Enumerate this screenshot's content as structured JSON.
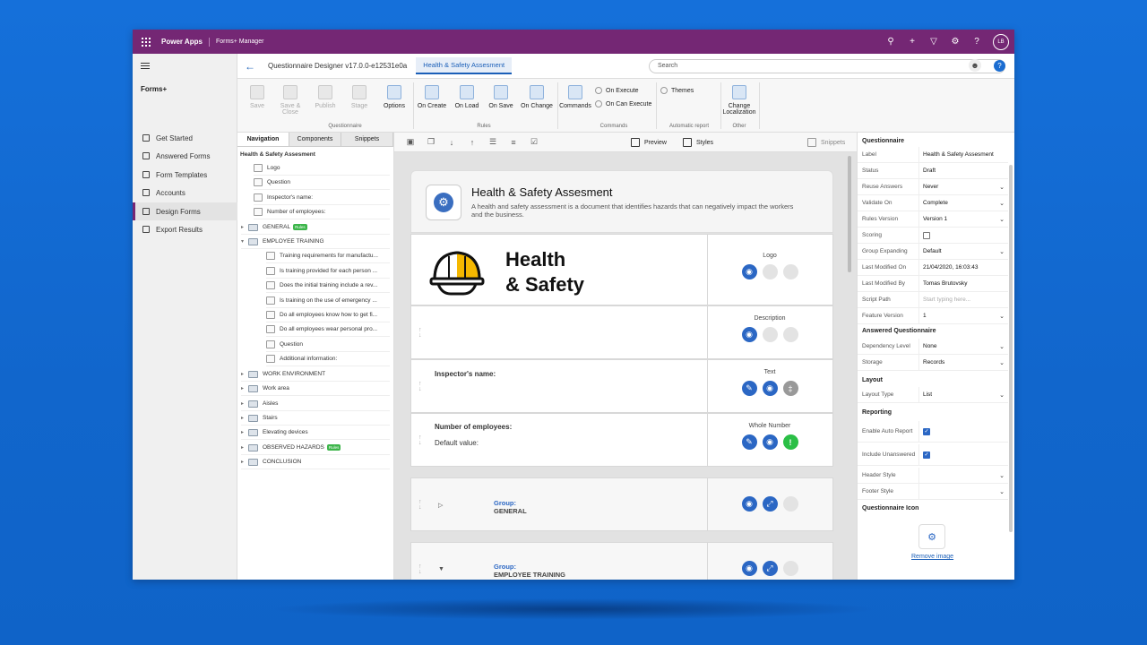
{
  "colors": {
    "accent": "#742774",
    "primary": "#2b67c4",
    "success": "#2bbf46",
    "background": "#1474d6"
  },
  "topbar": {
    "app_name": "Power Apps",
    "sub_app": "Forms+ Manager",
    "avatar": "LB",
    "icons": [
      "search-icon",
      "add-icon",
      "filter-icon",
      "gear-icon",
      "help-icon"
    ]
  },
  "leftnav": {
    "title": "Forms+",
    "items": [
      {
        "label": "Get Started",
        "icon": "doc-icon"
      },
      {
        "label": "Answered Forms",
        "icon": "doc-edit-icon"
      },
      {
        "label": "Form Templates",
        "icon": "template-icon"
      },
      {
        "label": "Accounts",
        "icon": "building-icon"
      },
      {
        "label": "Design Forms",
        "icon": "design-icon"
      },
      {
        "label": "Export Results",
        "icon": "export-icon"
      }
    ]
  },
  "header": {
    "designer_title": "Questionnaire Designer v17.0.0-e12531e0a",
    "tab": "Health & Safety Assesment",
    "search_placeholder": "Search"
  },
  "ribbon": {
    "buttons": [
      "Save",
      "Save & Close",
      "Publish",
      "Stage",
      "Options",
      "On Create",
      "On Load",
      "On Save",
      "On Change",
      "Commands",
      "Themes",
      "Change Localization"
    ],
    "small": [
      "On Execute",
      "On Can Execute"
    ],
    "groups": [
      "Questionnaire",
      "Rules",
      "Commands",
      "Automatic report",
      "Other"
    ]
  },
  "panel": {
    "tabs": [
      "Navigation",
      "Components",
      "Snippets"
    ],
    "root": "Health & Safety Assesment",
    "nodes": [
      "Logo",
      "Question",
      "Inspector's name:",
      "Number of employees:",
      "GENERAL",
      "EMPLOYEE TRAINING",
      "Training requirements for manufactu...",
      "Is training provided for each person ...",
      "Does the initial training include a rev...",
      "Is training on the use of emergency ...",
      "Do all employees know how to get fi...",
      "Do all employees wear personal pro...",
      "Question",
      "Additional information:",
      "WORK ENVIRONMENT",
      "Work area",
      "Aisles",
      "Stairs",
      "Elevating devices",
      "OBSERVED HAZARDS",
      "CONCLUSION"
    ],
    "badge": "Rules"
  },
  "canvas": {
    "preview": "Preview",
    "styles": "Styles",
    "snippets": "Snippets",
    "title": "Health & Safety Assesment",
    "description": "A health and safety assessment is a document that identifies hazards that can negatively impact the workers and the business.",
    "logo_text": [
      "Health",
      "& Safety"
    ],
    "rows": [
      {
        "type": "Logo"
      },
      {
        "type": "Description"
      },
      {
        "type": "Text",
        "label": "Inspector's name:"
      },
      {
        "type": "Whole Number",
        "label": "Number of employees:",
        "sub": "Default value:"
      }
    ],
    "groups": [
      {
        "g": "Group:",
        "name": "GENERAL"
      },
      {
        "g": "Group:",
        "name": "EMPLOYEE TRAINING"
      }
    ]
  },
  "props": {
    "sections": [
      "Questionnaire",
      "Answered Questionnaire",
      "Layout",
      "Reporting",
      "Questionnaire Icon"
    ],
    "rows": [
      {
        "k": "Label",
        "v": "Health & Safety Assesment"
      },
      {
        "k": "Status",
        "v": "Draft"
      },
      {
        "k": "Reuse Answers",
        "v": "Never"
      },
      {
        "k": "Validate On",
        "v": "Complete"
      },
      {
        "k": "Rules Version",
        "v": "Version 1"
      },
      {
        "k": "Scoring",
        "v": ""
      },
      {
        "k": "Group Expanding",
        "v": "Default"
      },
      {
        "k": "Last Modified On",
        "v": "21/04/2020, 16:03:43"
      },
      {
        "k": "Last Modified By",
        "v": "Tomas Brutovsky"
      },
      {
        "k": "Script Path",
        "v": "Start typing here..."
      },
      {
        "k": "Feature Version",
        "v": "1"
      },
      {
        "k": "Dependency Level",
        "v": "None"
      },
      {
        "k": "Storage",
        "v": "Records"
      },
      {
        "k": "Layout Type",
        "v": "List"
      },
      {
        "k": "Enable Auto Report",
        "v": ""
      },
      {
        "k": "Include Unanswered",
        "v": ""
      },
      {
        "k": "Header Style",
        "v": ""
      },
      {
        "k": "Footer Style",
        "v": ""
      }
    ],
    "remove_image": "Remove image"
  }
}
